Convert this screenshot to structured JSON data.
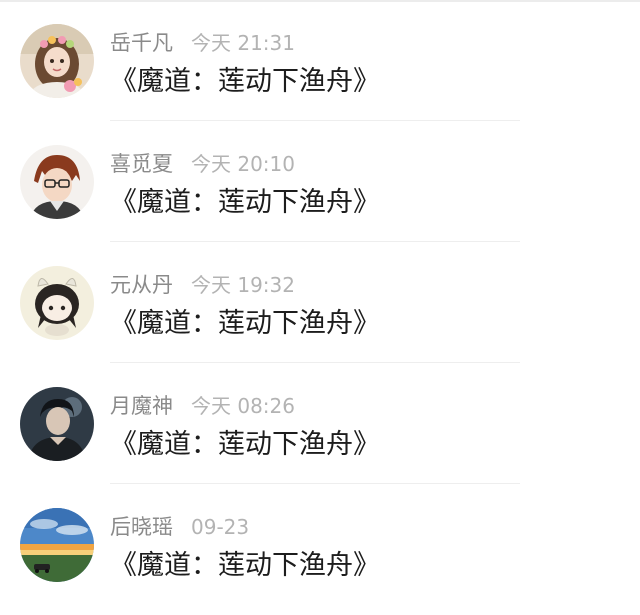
{
  "comments": [
    {
      "name": "岳千凡",
      "time": "今天 21:31",
      "text": "《魔道：莲动下渔舟》",
      "avatar": "girl-with-flowers-avatar"
    },
    {
      "name": "喜觅夏",
      "time": "今天 20:10",
      "text": "《魔道：莲动下渔舟》",
      "avatar": "anime-boy-glasses-avatar"
    },
    {
      "name": "元从丹",
      "time": "今天 19:32",
      "text": "《魔道：莲动下渔舟》",
      "avatar": "chibi-girl-avatar"
    },
    {
      "name": "月魔神",
      "time": "今天 08:26",
      "text": "《魔道：莲动下渔舟》",
      "avatar": "dark-portrait-avatar"
    },
    {
      "name": "后晓瑶",
      "time": "09-23",
      "text": "《魔道：莲动下渔舟》",
      "avatar": "landscape-sunset-avatar"
    }
  ],
  "colors": {
    "name": "#8a8a8a",
    "time": "#b3b3b3",
    "text": "#1d1d1d",
    "separator": "#eeeeee"
  }
}
